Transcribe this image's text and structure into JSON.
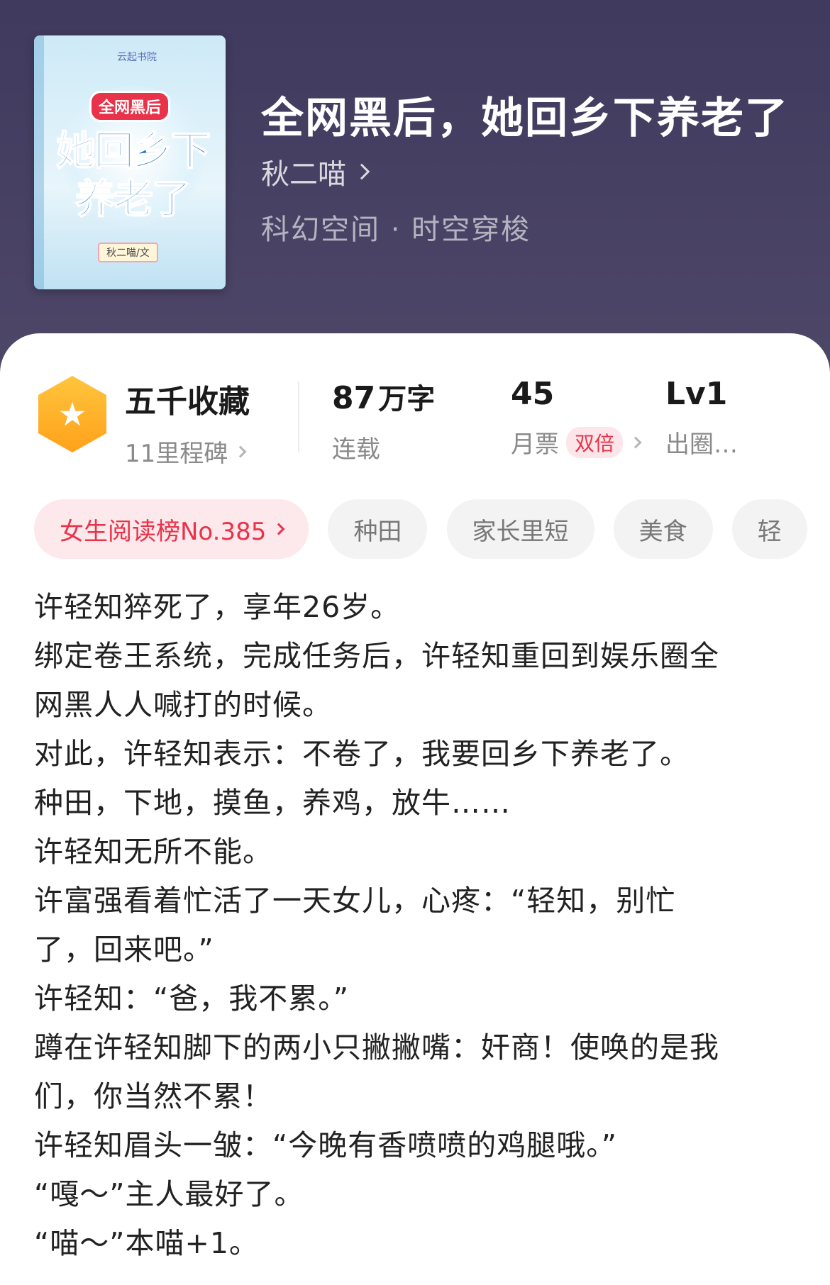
{
  "book": {
    "title": "全网黑后，她回乡下养老了",
    "author": "秋二喵",
    "genre": "科幻空间 · 时空穿梭",
    "cover": {
      "publisher_logo": "云起书院",
      "badge": "全网黑后",
      "title_line1": "她回乡下",
      "title_line2": "养老了",
      "author_tag": "秋二喵/文"
    }
  },
  "stats": {
    "favorites": {
      "value": "五千收藏",
      "sub": "11里程碑",
      "icon": "star-badge-icon"
    },
    "words": {
      "value": "87",
      "unit": "万字",
      "sub": "连载"
    },
    "monthly": {
      "value": "45",
      "sub": "月票",
      "tag": "双倍"
    },
    "level": {
      "value": "Lv1",
      "sub": "出圈…"
    }
  },
  "tags": {
    "rank": "女生阅读榜No.385",
    "items": [
      "种田",
      "家长里短",
      "美食",
      "轻"
    ]
  },
  "description": [
    "许轻知猝死了，享年26岁。",
    "绑定卷王系统，完成任务后，许轻知重回到娱乐圈全",
    "网黑人人喊打的时候。",
    "对此，许轻知表示：不卷了，我要回乡下养老了。",
    "种田，下地，摸鱼，养鸡，放牛……",
    "许轻知无所不能。",
    "许富强看着忙活了一天女儿，心疼：“轻知，别忙",
    "了，回来吧。”",
    "许轻知：“爸，我不累。”",
    "蹲在许轻知脚下的两小只撇撇嘴：奸商！使唤的是我",
    "们，你当然不累！",
    "许轻知眉头一皱：“今晚有香喷喷的鸡腿哦。”",
    "“嘎～”主人最好了。",
    "“喵～”本喵+1。"
  ],
  "colors": {
    "header_bg": "#4a4466",
    "accent_red": "#e8334a",
    "star_orange": "#ffa11a"
  }
}
